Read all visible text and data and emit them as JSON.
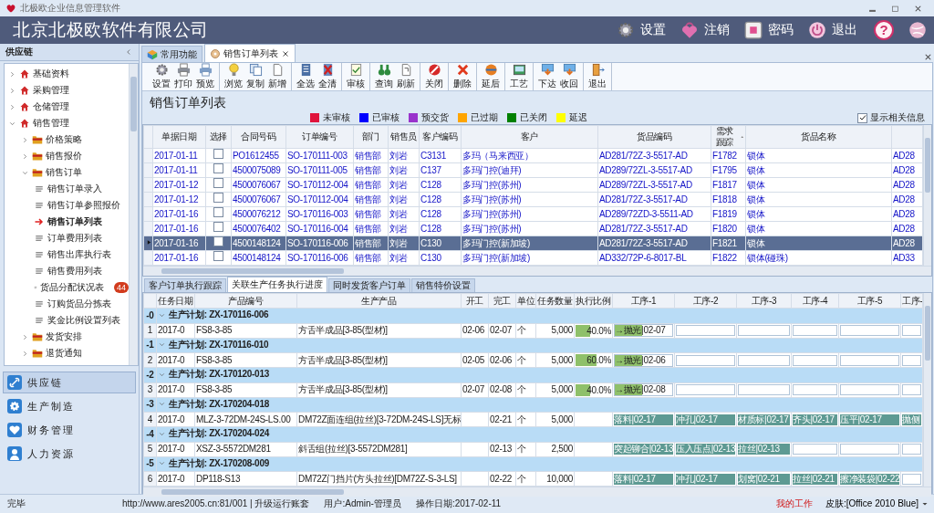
{
  "title_bar": {
    "title": "北极欧企业信息管理软件"
  },
  "header": {
    "company": "北京北极欧软件有限公司",
    "actions": [
      {
        "label": "设置"
      },
      {
        "label": "注销"
      },
      {
        "label": "密码"
      },
      {
        "label": "退出"
      }
    ],
    "help": "?"
  },
  "sidebar": {
    "title": "供应链",
    "tree": [
      {
        "label": "基础资料",
        "expanded": false,
        "selected": false
      },
      {
        "label": "采购管理",
        "expanded": false,
        "selected": false
      },
      {
        "label": "仓储管理",
        "expanded": false,
        "selected": false
      },
      {
        "label": "销售管理",
        "expanded": true,
        "selected": false,
        "children": [
          {
            "label": "价格策略",
            "expanded": false,
            "selected": false
          },
          {
            "label": "销售报价",
            "expanded": false,
            "selected": false
          },
          {
            "label": "销售订单",
            "expanded": true,
            "selected": false,
            "children": [
              {
                "label": "销售订单录入",
                "selected": false
              },
              {
                "label": "销售订单参照报价",
                "selected": false
              },
              {
                "label": "销售订单列表",
                "selected": true
              },
              {
                "label": "订单费用列表",
                "selected": false
              },
              {
                "label": "销售出库执行表",
                "selected": false
              },
              {
                "label": "销售费用列表",
                "selected": false
              },
              {
                "label": "货品分配状况表",
                "selected": false,
                "badge": "44"
              },
              {
                "label": "订购货品分拣表",
                "selected": false
              },
              {
                "label": "奖金比例设置列表",
                "selected": false
              }
            ]
          },
          {
            "label": "发货安排",
            "expanded": false,
            "selected": false
          },
          {
            "label": "退货通知",
            "expanded": false,
            "selected": false
          }
        ]
      }
    ],
    "modules": [
      {
        "label": "供应链",
        "selected": true
      },
      {
        "label": "生产制造",
        "selected": false
      },
      {
        "label": "财务管理",
        "selected": false
      },
      {
        "label": "人力资源",
        "selected": false
      }
    ]
  },
  "tabs": [
    {
      "label": "常用功能",
      "selected": false
    },
    {
      "label": "销售订单列表",
      "selected": true
    }
  ],
  "toolbar": [
    [
      {
        "label": "设置"
      },
      {
        "label": "打印"
      },
      {
        "label": "预览"
      }
    ],
    [
      {
        "label": "浏览"
      },
      {
        "label": "复制"
      },
      {
        "label": "新增"
      }
    ],
    [
      {
        "label": "全选"
      },
      {
        "label": "全清"
      }
    ],
    [
      {
        "label": "审核"
      }
    ],
    [
      {
        "label": "查询"
      },
      {
        "label": "刷新"
      }
    ],
    [
      {
        "label": "关闭"
      }
    ],
    [
      {
        "label": "删除"
      }
    ],
    [
      {
        "label": "延后"
      }
    ],
    [
      {
        "label": "工艺"
      }
    ],
    [
      {
        "label": "下达"
      },
      {
        "label": "收回"
      }
    ],
    [
      {
        "label": "退出"
      }
    ]
  ],
  "list_title": "销售订单列表",
  "legend": [
    {
      "label": "未审核",
      "color": "#e0143c"
    },
    {
      "label": "已审核",
      "color": "#0000ff"
    },
    {
      "label": "预交货",
      "color": "#9932cc"
    },
    {
      "label": "已过期",
      "color": "#ffa500"
    },
    {
      "label": "已关闭",
      "color": "#008000"
    },
    {
      "label": "延迟",
      "color": "#ffff00"
    }
  ],
  "show_related": {
    "label": "显示相关信息",
    "checked": true
  },
  "orders": {
    "columns": [
      "单据日期",
      "选择",
      "合同号码",
      "订单编号",
      "部门",
      "销售员",
      "客户编码",
      "客户",
      "货品编码",
      "需求跟踪",
      "货品名称"
    ],
    "rows": [
      {
        "date": "2017-01-11",
        "checked": false,
        "contract": "PO1612455",
        "order_no": "SO-170111-003",
        "dept": "销售部",
        "salesperson": "刘岩",
        "customer_code": "C3131",
        "customer": "多玛（马来西亚）",
        "item_code": "AD281/72Z-3-5517-AD",
        "demand": "F1782",
        "item_name": "锁体",
        "column_13": "AD28",
        "selected": false
      },
      {
        "date": "2017-01-11",
        "checked": false,
        "contract": "4500075089",
        "order_no": "SO-170111-005",
        "dept": "销售部",
        "salesperson": "刘岩",
        "customer_code": "C137",
        "customer": "多玛门控(迪拜)",
        "item_code": "AD289/72ZL-3-5517-AD",
        "demand": "F1795",
        "item_name": "锁体",
        "column_13": "AD28",
        "selected": false
      },
      {
        "date": "2017-01-12",
        "checked": false,
        "contract": "4500076067",
        "order_no": "SO-170112-004",
        "dept": "销售部",
        "salesperson": "刘岩",
        "customer_code": "C128",
        "customer": "多玛门控(苏州)",
        "item_code": "AD289/72ZL-3-5517-AD",
        "demand": "F1817",
        "item_name": "锁体",
        "column_13": "AD28",
        "selected": false
      },
      {
        "date": "2017-01-12",
        "checked": false,
        "contract": "4500076067",
        "order_no": "SO-170112-004",
        "dept": "销售部",
        "salesperson": "刘岩",
        "customer_code": "C128",
        "customer": "多玛门控(苏州)",
        "item_code": "AD281/72Z-3-5517-AD",
        "demand": "F1818",
        "item_name": "锁体",
        "column_13": "AD28",
        "selected": false
      },
      {
        "date": "2017-01-16",
        "checked": false,
        "contract": "4500076212",
        "order_no": "SO-170116-003",
        "dept": "销售部",
        "salesperson": "刘岩",
        "customer_code": "C128",
        "customer": "多玛门控(苏州)",
        "item_code": "AD289/72ZD-3-5511-AD",
        "demand": "F1819",
        "item_name": "锁体",
        "column_13": "AD28",
        "selected": false
      },
      {
        "date": "2017-01-16",
        "checked": false,
        "contract": "4500076402",
        "order_no": "SO-170116-004",
        "dept": "销售部",
        "salesperson": "刘岩",
        "customer_code": "C128",
        "customer": "多玛门控(苏州)",
        "item_code": "AD281/72Z-3-5517-AD",
        "demand": "F1820",
        "item_name": "锁体",
        "column_13": "AD28",
        "selected": false
      },
      {
        "date": "2017-01-16",
        "checked": false,
        "contract": "4500148124",
        "order_no": "SO-170116-006",
        "dept": "销售部",
        "salesperson": "刘岩",
        "customer_code": "C130",
        "customer": "多玛门控(新加坡)",
        "item_code": "AD281/72Z-3-5517-AD",
        "demand": "F1821",
        "item_name": "锁体",
        "column_13": "AD28",
        "selected": true
      },
      {
        "date": "2017-01-16",
        "checked": false,
        "contract": "4500148124",
        "order_no": "SO-170116-006",
        "dept": "销售部",
        "salesperson": "刘岩",
        "customer_code": "C130",
        "customer": "多玛门控(新加坡)",
        "item_code": "AD332/72P-6-8017-BL",
        "demand": "F1822",
        "item_name": "锁体(碰珠)",
        "column_13": "AD33",
        "selected": false
      }
    ]
  },
  "detail_tabs": [
    {
      "label": "客户订单执行跟踪",
      "selected": false
    },
    {
      "label": "关联生产任务执行进度",
      "selected": true
    },
    {
      "label": "同时发货客户订单",
      "selected": false
    },
    {
      "label": "销售特价设置",
      "selected": false
    }
  ],
  "tasks": {
    "columns": [
      "任务日期",
      "产品编号",
      "生产产品",
      "开工",
      "完工",
      "单位",
      "任务数量",
      "执行比例",
      "工序-1",
      "工序-2",
      "工序-3",
      "工序-4",
      "工序-5",
      "工序-"
    ],
    "groups": [
      {
        "number": "-0",
        "plan": "生产计划: ZX-170116-006",
        "expanded": true,
        "rows": [
          {
            "number": "1",
            "date": "2017-0",
            "code": "FS8-3-85",
            "product": "方舌半成品[3-85(型材)]",
            "start": "02-06",
            "end": "02-07",
            "unit": "个",
            "qty": "5,000",
            "ratio": {
              "level": 0.4,
              "text": "40.0%"
            },
            "steps": [
              {
                "kind": "current",
                "text": "→抛光|02-07"
              },
              {
                "kind": "empty"
              },
              {
                "kind": "empty"
              },
              {
                "kind": "empty"
              },
              {
                "kind": "empty"
              },
              {
                "kind": "empty"
              }
            ]
          }
        ]
      },
      {
        "number": "-1",
        "plan": "生产计划: ZX-170116-010",
        "expanded": true,
        "rows": [
          {
            "number": "2",
            "date": "2017-0",
            "code": "FS8-3-85",
            "product": "方舌半成品[3-85(型材)]",
            "start": "02-05",
            "end": "02-06",
            "unit": "个",
            "qty": "5,000",
            "ratio": {
              "level": 0.6,
              "text": "60.0%"
            },
            "steps": [
              {
                "kind": "current",
                "text": "→抛光|02-06"
              },
              {
                "kind": "empty"
              },
              {
                "kind": "empty"
              },
              {
                "kind": "empty"
              },
              {
                "kind": "empty"
              },
              {
                "kind": "empty"
              }
            ]
          }
        ]
      },
      {
        "number": "-2",
        "plan": "生产计划: ZX-170120-013",
        "expanded": true,
        "rows": [
          {
            "number": "3",
            "date": "2017-0",
            "code": "FS8-3-85",
            "product": "方舌半成品[3-85(型材)]",
            "start": "02-07",
            "end": "02-08",
            "unit": "个",
            "qty": "5,000",
            "ratio": {
              "level": 0.4,
              "text": "40.0%"
            },
            "steps": [
              {
                "kind": "current",
                "text": "→抛光|02-08"
              },
              {
                "kind": "empty"
              },
              {
                "kind": "empty"
              },
              {
                "kind": "empty"
              },
              {
                "kind": "empty"
              },
              {
                "kind": "empty"
              }
            ]
          }
        ]
      },
      {
        "number": "-3",
        "plan": "生产计划: ZX-170204-018",
        "expanded": true,
        "rows": [
          {
            "number": "4",
            "date": "2017-0",
            "code": "MLZ-3-72DM-24S-LS.00",
            "product": "DM72Z面连组(拉丝)[3-72DM-24S-LS]无标",
            "end": "02-21",
            "unit": "个",
            "qty": "5,000",
            "steps": [
              {
                "kind": "done",
                "text": "落料|02-17"
              },
              {
                "kind": "done",
                "text": "冲孔|02-17"
              },
              {
                "kind": "done",
                "text": "材质标|02-17"
              },
              {
                "kind": "done",
                "text": "齐头|02-17"
              },
              {
                "kind": "done",
                "text": "压平|02-17"
              },
              {
                "kind": "done",
                "text": "抛侧"
              }
            ]
          }
        ]
      },
      {
        "number": "-4",
        "plan": "生产计划: ZX-170204-024",
        "expanded": true,
        "rows": [
          {
            "number": "5",
            "date": "2017-0",
            "code": "XSZ-3-5572DM281",
            "product": "斜舌组(拉丝)[3-5572DM281]",
            "end": "02-13",
            "unit": "个",
            "qty": "2,500",
            "steps": [
              {
                "kind": "done",
                "text": "突起铆合|02-13"
              },
              {
                "kind": "done",
                "text": "压入压点|02-13"
              },
              {
                "kind": "done",
                "text": "拉丝|02-13"
              },
              {
                "kind": "empty"
              },
              {
                "kind": "empty"
              },
              {
                "kind": "empty"
              }
            ]
          }
        ]
      },
      {
        "number": "-5",
        "plan": "生产计划: ZX-170208-009",
        "expanded": true,
        "rows": [
          {
            "number": "6",
            "date": "2017-0",
            "code": "DP118-S13",
            "product": "DM72Z门挡片(方头拉丝)[DM72Z-S-3-LS]",
            "end": "02-22",
            "unit": "个",
            "qty": "10,000",
            "steps": [
              {
                "kind": "done",
                "text": "落料|02-17"
              },
              {
                "kind": "done",
                "text": "冲孔|02-17"
              },
              {
                "kind": "done",
                "text": "划窝|02-21"
              },
              {
                "kind": "done",
                "text": "拉丝|02-21"
              },
              {
                "kind": "done",
                "text": "擦净装袋|02-22"
              },
              {
                "kind": "empty"
              }
            ]
          }
        ]
      }
    ]
  },
  "status_bar": {
    "state": "完毕",
    "url": "http://www.ares2005.cn:81/001 | 升级运行账套",
    "user": "用户:Admin-管理员",
    "date": "操作日期:2017-02-11",
    "work": "我的工作",
    "skin": "皮肤:[Office 2010 Blue]"
  }
}
